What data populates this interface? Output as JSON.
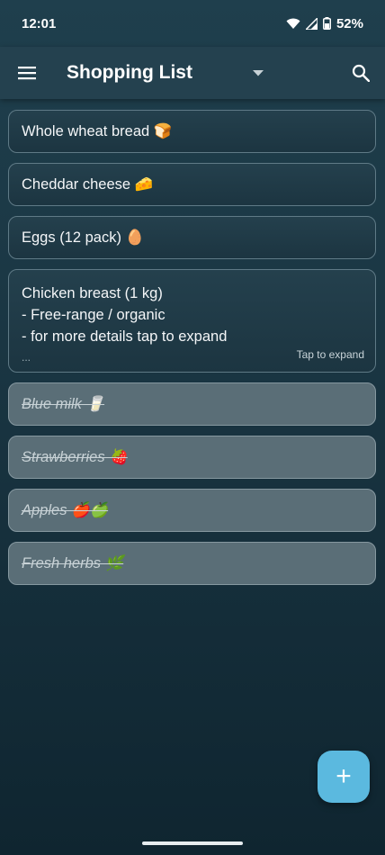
{
  "status": {
    "time": "12:01",
    "battery": "52%"
  },
  "appbar": {
    "title": "Shopping List"
  },
  "items": [
    {
      "text": "Whole wheat bread 🍞"
    },
    {
      "text": "Cheddar cheese 🧀"
    },
    {
      "text": "Eggs (12 pack) 🥚"
    },
    {
      "line1": "Chicken breast (1 kg)",
      "line2": "- Free-range / organic",
      "line3": "- for more details tap to expand",
      "ellipsis": "...",
      "hint": "Tap to expand"
    },
    {
      "text": "Blue milk 🥛"
    },
    {
      "text": "Strawberries 🍓"
    },
    {
      "text": "Apples 🍎🍏"
    },
    {
      "text": "Fresh herbs 🌿"
    }
  ],
  "fab": {
    "label": "+"
  },
  "colors": {
    "accent": "#5bb9df",
    "appbar": "#24414f",
    "done_item": "#5a6e77"
  }
}
